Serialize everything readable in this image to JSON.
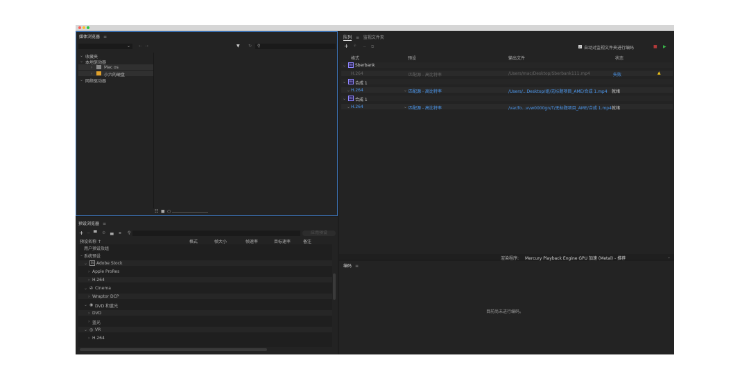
{
  "media_browser": {
    "title": "媒体浏览器",
    "menu_icon": "≡",
    "tree": [
      "收藏夹",
      "本地驱动器",
      "Mac os",
      "小六的硬盘",
      "网络驱动器"
    ]
  },
  "preset_browser": {
    "title": "预设浏览器",
    "menu_icon": "≡",
    "apply_button": "应用预设",
    "columns": [
      "预设名称 ↑",
      "格式",
      "帧大小",
      "帧速率",
      "目标速率",
      "备注"
    ],
    "items": [
      "用户预设及组",
      "系统预设",
      "Adobe Stock",
      "Apple ProRes",
      "H.264",
      "Cinema",
      "Wraptor DCP",
      "DVD 和蓝光",
      "DVD",
      "蓝光",
      "VR",
      "H.264"
    ]
  },
  "queue": {
    "tabs": [
      "队列",
      "监视文件夹"
    ],
    "menu_icon": "≡",
    "auto_encode_label": "自动对监视文件夹进行编码",
    "columns": [
      "格式",
      "预设",
      "输出文件",
      "状态"
    ],
    "groups": [
      {
        "name": "Sberbank",
        "format": "H.264",
        "preset": "匹配源 - 高比特率",
        "output": "/Users/mac/Desktop/Sberbank111.mp4",
        "status": "失败"
      },
      {
        "name": "合成 1",
        "format": "H.264",
        "preset": "匹配源 - 高比特率",
        "output": "/Users/...Desktop/组/无标题项目_AME/合成 1.mp4",
        "status": "就绪"
      },
      {
        "name": "合成 1",
        "format": "H.264",
        "preset": "匹配源 - 高比特率",
        "output": "/var/fo...vvw0000gn/T/无标题项目_AME/合成 1.mp4",
        "status": "就绪"
      }
    ],
    "renderer_label": "渲染程序:",
    "renderer_value": "Mercury Playback Engine GPU 加速 (Metal) - 推荐"
  },
  "encoding": {
    "title": "编码",
    "menu_icon": "≡",
    "empty_message": "目前尚未进行编码。"
  },
  "colors": {
    "accent": "#4c98ef",
    "panel_bg": "#232323",
    "app_bg": "#1d1d1d",
    "focus_border": "#3a6fb0"
  }
}
